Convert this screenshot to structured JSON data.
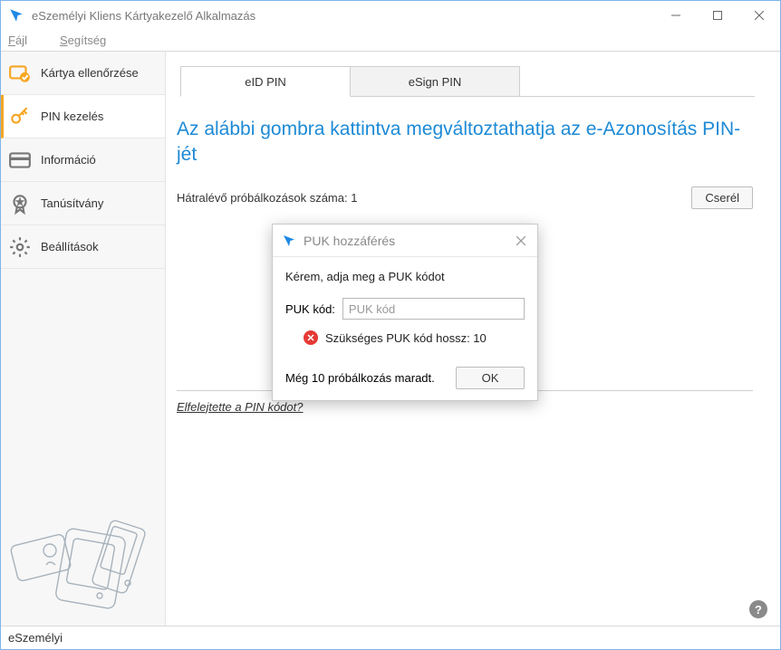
{
  "window": {
    "title": "eSzemélyi Kliens Kártyakezelő Alkalmazás"
  },
  "menubar": {
    "file": "Fájl",
    "help": "Segítség"
  },
  "sidebar": {
    "items": [
      {
        "id": "card-check",
        "label": "Kártya ellenőrzése"
      },
      {
        "id": "pin-mgmt",
        "label": "PIN kezelés"
      },
      {
        "id": "info",
        "label": "Információ"
      },
      {
        "id": "cert",
        "label": "Tanúsítvány"
      },
      {
        "id": "settings",
        "label": "Beállítások"
      }
    ]
  },
  "tabs": {
    "eid": "eID PIN",
    "esign": "eSign PIN"
  },
  "main": {
    "heading": "Az alábbi gombra kattintva megváltoztathatja az e-Azonosítás PIN-jét",
    "attempts_label": "Hátralévő próbálkozások száma: 1",
    "change_button": "Cserél",
    "forgot_link": "Elfelejtette a PIN kódot?"
  },
  "dialog": {
    "title": "PUK hozzáférés",
    "message": "Kérem, adja meg a PUK kódot",
    "field_label": "PUK kód:",
    "placeholder": "PUK kód",
    "error": "Szükséges PUK kód hossz: 10",
    "remaining": "Még 10 próbálkozás maradt.",
    "ok": "OK"
  },
  "statusbar": {
    "text": "eSzemélyi"
  },
  "help_tooltip": "?"
}
